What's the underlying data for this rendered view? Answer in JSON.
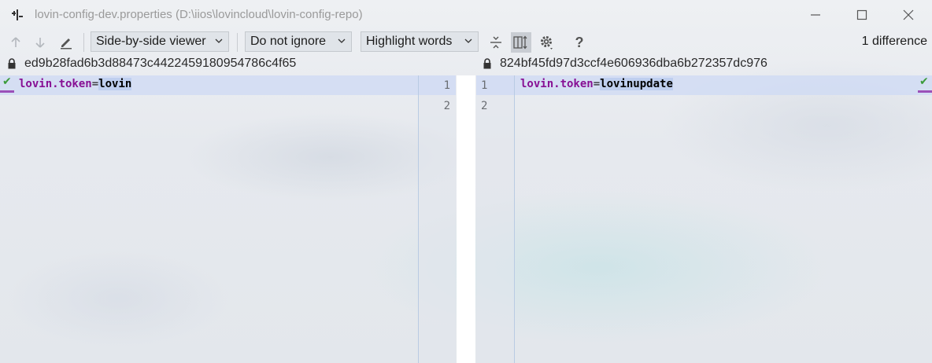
{
  "window": {
    "title": "lovin-config-dev.properties (D:\\iios\\lovincloud\\lovin-config-repo)",
    "controls": [
      "minimize",
      "maximize",
      "close"
    ]
  },
  "toolbar": {
    "viewer_mode": "Side-by-side viewer",
    "ignore_mode": "Do not ignore",
    "highlight_mode": "Highlight words",
    "help_label": "?",
    "difference_count": "1 difference",
    "icons": [
      "arrow-up-icon",
      "arrow-down-icon",
      "edit-icon",
      "collapse-icon",
      "sync-scroll-icon",
      "gear-icon",
      "help-icon"
    ]
  },
  "left": {
    "revision": "ed9b28fad6b3d88473c4422459180954786c4f65",
    "lines": [
      {
        "number": "1",
        "key": "lovin.token",
        "eq": "=",
        "value": "lovin"
      },
      {
        "number": "2",
        "key": "",
        "eq": "",
        "value": ""
      }
    ]
  },
  "right": {
    "revision": "824bf45fd97d3ccf4e606936dba6b272357dc976",
    "lines": [
      {
        "number": "1",
        "key": "lovin.token",
        "eq": "=",
        "value": "lovinupdate"
      },
      {
        "number": "2",
        "key": "",
        "eq": "",
        "value": ""
      }
    ]
  },
  "colors": {
    "key": "#871094",
    "changed_line": "#cddaf4",
    "accept_check": "#3b9b3b",
    "marker": "#9b50b8"
  }
}
